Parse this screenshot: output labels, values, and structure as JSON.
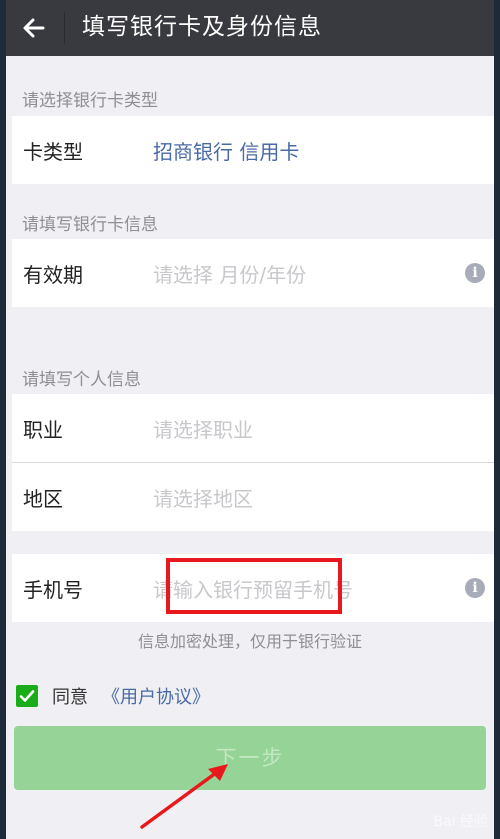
{
  "header": {
    "title": "填写银行卡及身份信息"
  },
  "card_section": {
    "header": "请选择银行卡类型",
    "type_label": "卡类型",
    "type_value": "招商银行 信用卡"
  },
  "card_info_section": {
    "header": "请填写银行卡信息",
    "expiry_label": "有效期",
    "expiry_placeholder": "请选择 月份/年份"
  },
  "personal_section": {
    "header": "请填写个人信息",
    "job_label": "职业",
    "job_placeholder": "请选择职业",
    "region_label": "地区",
    "region_placeholder": "请选择地区"
  },
  "phone": {
    "label": "手机号",
    "placeholder": "请输入银行预留手机号"
  },
  "hint": "信息加密处理，仅用于银行验证",
  "agreement": {
    "checked": true,
    "agree_text": "同意",
    "link_text": "《用户协议》"
  },
  "next_button": "下一步",
  "watermark": "Bai 经验",
  "colors": {
    "topbar": "#393a3f",
    "accent_green": "#1aad19",
    "button_disabled": "#96d396",
    "link_blue": "#4a6aa5",
    "annotation_red": "#e8191d"
  },
  "icons": [
    "back-arrow-icon",
    "info-icon",
    "checkmark-icon"
  ]
}
